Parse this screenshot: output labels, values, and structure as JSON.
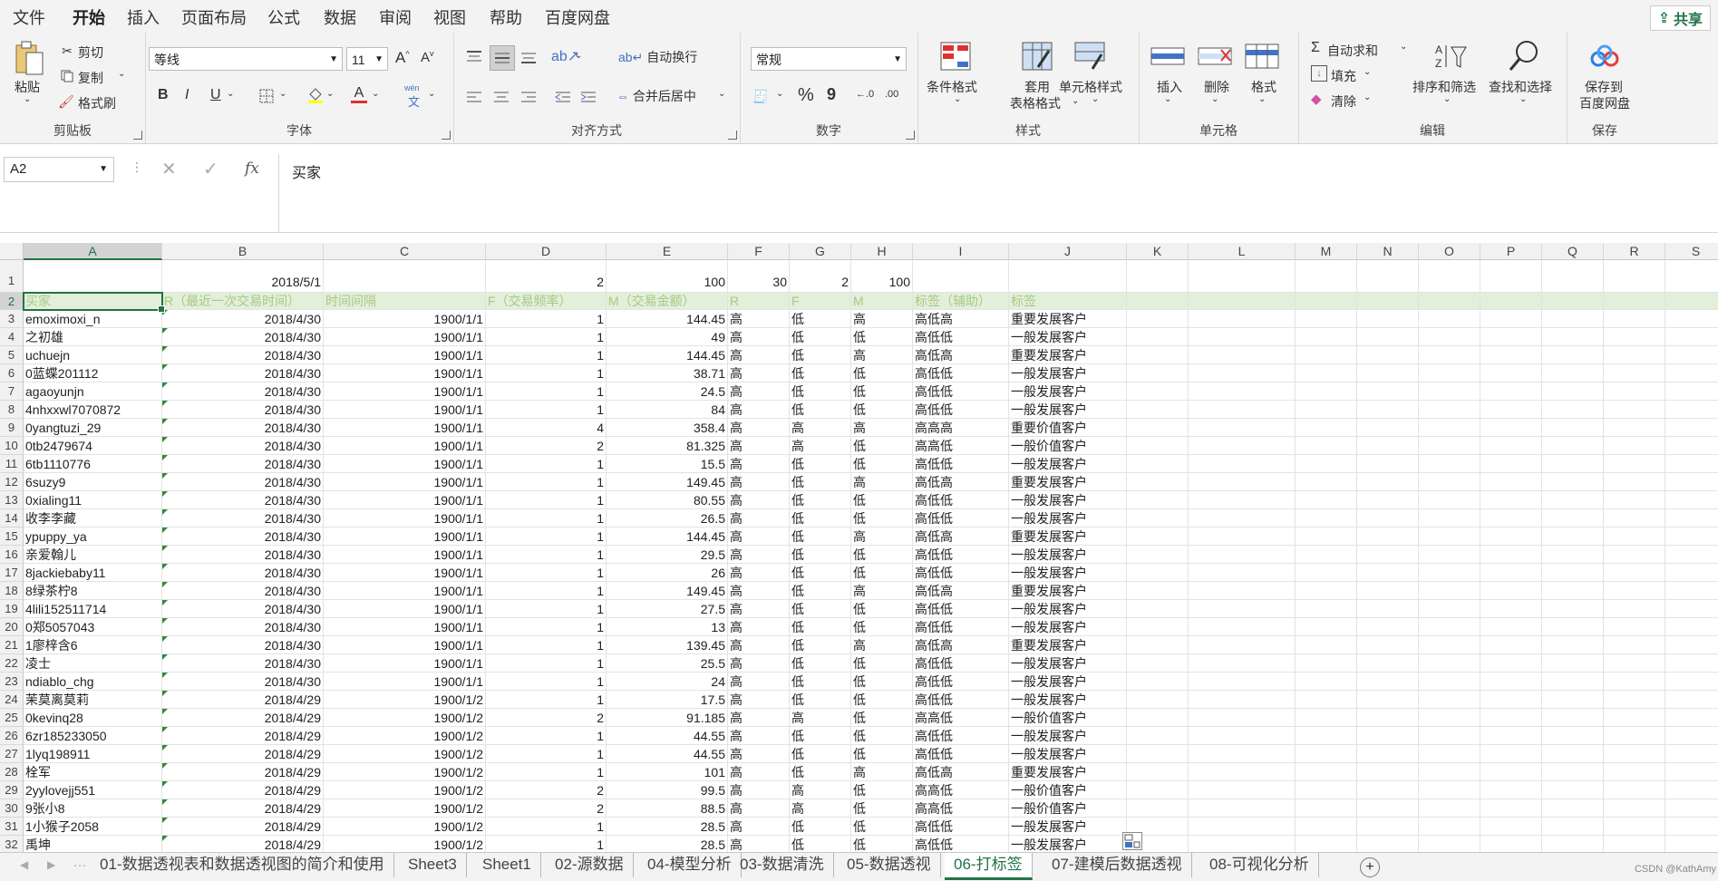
{
  "menu": {
    "tabs": [
      "文件",
      "开始",
      "插入",
      "页面布局",
      "公式",
      "数据",
      "审阅",
      "视图",
      "帮助",
      "百度网盘"
    ],
    "share": "共享"
  },
  "ribbon": {
    "clipboard": {
      "paste": "粘贴",
      "cut": "剪切",
      "copy": "复制",
      "painter": "格式刷",
      "label": "剪贴板"
    },
    "font": {
      "name": "等线",
      "size": "11",
      "bold": "B",
      "italic": "I",
      "underline": "U",
      "label": "字体",
      "pinyin": "wén"
    },
    "align": {
      "wrap": "自动换行",
      "merge": "合并后居中",
      "label": "对齐方式"
    },
    "number": {
      "format": "常规",
      "percent": "%",
      "comma": "9",
      "label": "数字",
      "inc": "←.0",
      "dec": ".00"
    },
    "styles": {
      "cond": "条件格式",
      "table1": "套用",
      "table2": "表格格式",
      "cellstyle": "单元格样式",
      "label": "样式"
    },
    "cells": {
      "insert": "插入",
      "delete": "删除",
      "format": "格式",
      "label": "单元格"
    },
    "edit": {
      "autosum": "自动求和",
      "fill": "填充",
      "clear": "清除",
      "sort": "排序和筛选",
      "find": "查找和选择",
      "label": "编辑"
    },
    "save": {
      "l1": "保存到",
      "l2": "百度网盘",
      "label": "保存"
    }
  },
  "formula": {
    "namebox": "A2",
    "value": "买家",
    "fx": "fx"
  },
  "columns": [
    "A",
    "B",
    "C",
    "D",
    "E",
    "F",
    "G",
    "H",
    "I",
    "J",
    "K",
    "L",
    "M",
    "N",
    "O",
    "P",
    "Q",
    "R",
    "S"
  ],
  "row1": {
    "B": "2018/5/1",
    "D": "2",
    "E": "100",
    "F": "30",
    "G": "2",
    "H": "100"
  },
  "header_row": [
    "买家",
    "R（最近一次交易时间）",
    "时间间隔",
    "F（交易频率）",
    "M（交易金额）",
    "R",
    "F",
    "M",
    "标签（辅助）",
    "标签"
  ],
  "rows": [
    [
      "emoximoxi_n",
      "2018/4/30",
      "1900/1/1",
      "1",
      "144.45",
      "高",
      "低",
      "高",
      "高低高",
      "重要发展客户"
    ],
    [
      "之初雄",
      "2018/4/30",
      "1900/1/1",
      "1",
      "49",
      "高",
      "低",
      "低",
      "高低低",
      "一般发展客户"
    ],
    [
      "uchuejn",
      "2018/4/30",
      "1900/1/1",
      "1",
      "144.45",
      "高",
      "低",
      "高",
      "高低高",
      "重要发展客户"
    ],
    [
      "0蓝蝶201112",
      "2018/4/30",
      "1900/1/1",
      "1",
      "38.71",
      "高",
      "低",
      "低",
      "高低低",
      "一般发展客户"
    ],
    [
      "agaoyunjn",
      "2018/4/30",
      "1900/1/1",
      "1",
      "24.5",
      "高",
      "低",
      "低",
      "高低低",
      "一般发展客户"
    ],
    [
      "4nhxxwl7070872",
      "2018/4/30",
      "1900/1/1",
      "1",
      "84",
      "高",
      "低",
      "低",
      "高低低",
      "一般发展客户"
    ],
    [
      "0yangtuzi_29",
      "2018/4/30",
      "1900/1/1",
      "4",
      "358.4",
      "高",
      "高",
      "高",
      "高高高",
      "重要价值客户"
    ],
    [
      "0tb2479674",
      "2018/4/30",
      "1900/1/1",
      "2",
      "81.325",
      "高",
      "高",
      "低",
      "高高低",
      "一般价值客户"
    ],
    [
      "6tb1110776",
      "2018/4/30",
      "1900/1/1",
      "1",
      "15.5",
      "高",
      "低",
      "低",
      "高低低",
      "一般发展客户"
    ],
    [
      "6suzy9",
      "2018/4/30",
      "1900/1/1",
      "1",
      "149.45",
      "高",
      "低",
      "高",
      "高低高",
      "重要发展客户"
    ],
    [
      "0xialing11",
      "2018/4/30",
      "1900/1/1",
      "1",
      "80.55",
      "高",
      "低",
      "低",
      "高低低",
      "一般发展客户"
    ],
    [
      "收李李藏",
      "2018/4/30",
      "1900/1/1",
      "1",
      "26.5",
      "高",
      "低",
      "低",
      "高低低",
      "一般发展客户"
    ],
    [
      "ypuppy_ya",
      "2018/4/30",
      "1900/1/1",
      "1",
      "144.45",
      "高",
      "低",
      "高",
      "高低高",
      "重要发展客户"
    ],
    [
      "亲爱翰儿",
      "2018/4/30",
      "1900/1/1",
      "1",
      "29.5",
      "高",
      "低",
      "低",
      "高低低",
      "一般发展客户"
    ],
    [
      "8jackiebaby11",
      "2018/4/30",
      "1900/1/1",
      "1",
      "26",
      "高",
      "低",
      "低",
      "高低低",
      "一般发展客户"
    ],
    [
      "8绿茶柠8",
      "2018/4/30",
      "1900/1/1",
      "1",
      "149.45",
      "高",
      "低",
      "高",
      "高低高",
      "重要发展客户"
    ],
    [
      "4lili152511714",
      "2018/4/30",
      "1900/1/1",
      "1",
      "27.5",
      "高",
      "低",
      "低",
      "高低低",
      "一般发展客户"
    ],
    [
      "0郑5057043",
      "2018/4/30",
      "1900/1/1",
      "1",
      "13",
      "高",
      "低",
      "低",
      "高低低",
      "一般发展客户"
    ],
    [
      "1廖梓含6",
      "2018/4/30",
      "1900/1/1",
      "1",
      "139.45",
      "高",
      "低",
      "高",
      "高低高",
      "重要发展客户"
    ],
    [
      "凌士",
      "2018/4/30",
      "1900/1/1",
      "1",
      "25.5",
      "高",
      "低",
      "低",
      "高低低",
      "一般发展客户"
    ],
    [
      "ndiablo_chg",
      "2018/4/30",
      "1900/1/1",
      "1",
      "24",
      "高",
      "低",
      "低",
      "高低低",
      "一般发展客户"
    ],
    [
      "茉莫离莫莉",
      "2018/4/29",
      "1900/1/2",
      "1",
      "17.5",
      "高",
      "低",
      "低",
      "高低低",
      "一般发展客户"
    ],
    [
      "0kevinq28",
      "2018/4/29",
      "1900/1/2",
      "2",
      "91.185",
      "高",
      "高",
      "低",
      "高高低",
      "一般价值客户"
    ],
    [
      "6zr185233050",
      "2018/4/29",
      "1900/1/2",
      "1",
      "44.55",
      "高",
      "低",
      "低",
      "高低低",
      "一般发展客户"
    ],
    [
      "1lyq198911",
      "2018/4/29",
      "1900/1/2",
      "1",
      "44.55",
      "高",
      "低",
      "低",
      "高低低",
      "一般发展客户"
    ],
    [
      "栓军",
      "2018/4/29",
      "1900/1/2",
      "1",
      "101",
      "高",
      "低",
      "高",
      "高低高",
      "重要发展客户"
    ],
    [
      "2yylovejj551",
      "2018/4/29",
      "1900/1/2",
      "2",
      "99.5",
      "高",
      "高",
      "低",
      "高高低",
      "一般价值客户"
    ],
    [
      "9张小8",
      "2018/4/29",
      "1900/1/2",
      "2",
      "88.5",
      "高",
      "高",
      "低",
      "高高低",
      "一般价值客户"
    ],
    [
      "1小猴子2058",
      "2018/4/29",
      "1900/1/2",
      "1",
      "28.5",
      "高",
      "低",
      "低",
      "高低低",
      "一般发展客户"
    ],
    [
      "禹坤",
      "2018/4/29",
      "1900/1/2",
      "1",
      "28.5",
      "高",
      "低",
      "低",
      "高低低",
      "一般发展客户"
    ]
  ],
  "sheets": [
    "01-数据透视表和数据透视图的简介和使用",
    "Sheet3",
    "Sheet1",
    "02-源数据",
    "04-模型分析",
    "03-数据清洗",
    "05-数据透视",
    "06-打标签",
    "07-建模后数据透视",
    "08-可视化分析"
  ],
  "active_sheet": "06-打标签",
  "watermark": "CSDN @KathAmy"
}
